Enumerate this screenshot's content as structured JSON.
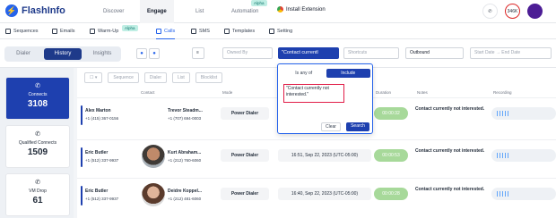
{
  "app": {
    "name": "FlashInfo",
    "nav": [
      "Discover",
      "Engage",
      "List",
      "Automation"
    ],
    "nav_active": "Engage",
    "automation_badge": "Alpha",
    "install": "Install Extension",
    "credits": "346K"
  },
  "subnav": {
    "items": [
      "Sequences",
      "Emails",
      "Warm-Up",
      "Calls",
      "SMS",
      "Templates",
      "Setting"
    ],
    "active": "Calls",
    "warmup_badge": "Alpha"
  },
  "toolbar": {
    "tabs": [
      "Dialer",
      "History",
      "Insights"
    ],
    "active_tab": "History",
    "owned_by_placeholder": "Owned By",
    "filter_chip": "\"Contact currentl",
    "shortcuts_placeholder": "Shortcuts",
    "direction": "Outbound",
    "start_date": "Start Date",
    "end_date": "End Date",
    "to": "→"
  },
  "stats": [
    {
      "label": "Connects",
      "value": "3108",
      "icon": "phone-icon"
    },
    {
      "label": "Qualified Connects",
      "value": "1509",
      "icon": "phone-check-icon"
    },
    {
      "label": "VM Drop",
      "value": "61",
      "icon": "voicemail-icon"
    }
  ],
  "actions": [
    "Sequence",
    "Dialer",
    "List",
    "Blocklist"
  ],
  "columns": [
    "Contact",
    "Mode",
    "Duration",
    "Notes",
    "Recording"
  ],
  "rows": [
    {
      "rep": "Alex Marton",
      "rep_phone": "+1 (415) 367-0156",
      "contact": "Trevor Steadm...",
      "contact_phone": "+1 (707) 694-0003",
      "mode": "Power Dialer",
      "time": "",
      "duration": "00:00:32",
      "note": "Contact currently not interested."
    },
    {
      "rep": "Eric Butler",
      "rep_phone": "+1 (512) 337-9937",
      "contact": "Kurt Abraham...",
      "contact_phone": "+1 (212) 760-6060",
      "mode": "Power Dialer",
      "time": "16:51, Sep 22, 2023 (UTC-05:00)",
      "duration": "00:00:53",
      "note": "Contact currently not interested."
    },
    {
      "rep": "Eric Butler",
      "rep_phone": "+1 (512) 337-9937",
      "contact": "Deidre Koppel...",
      "contact_phone": "+1 (212) 481-6060",
      "mode": "Power Dialer",
      "time": "16:40, Sep 22, 2023 (UTC-05:00)",
      "duration": "00:00:28",
      "note": "Contact currently not interested."
    }
  ],
  "popup": {
    "tab_is_any_of": "Is any of",
    "tab_include": "Include",
    "value": "\"Contact currently not interested.\"",
    "clear": "Clear",
    "search": "Search"
  }
}
